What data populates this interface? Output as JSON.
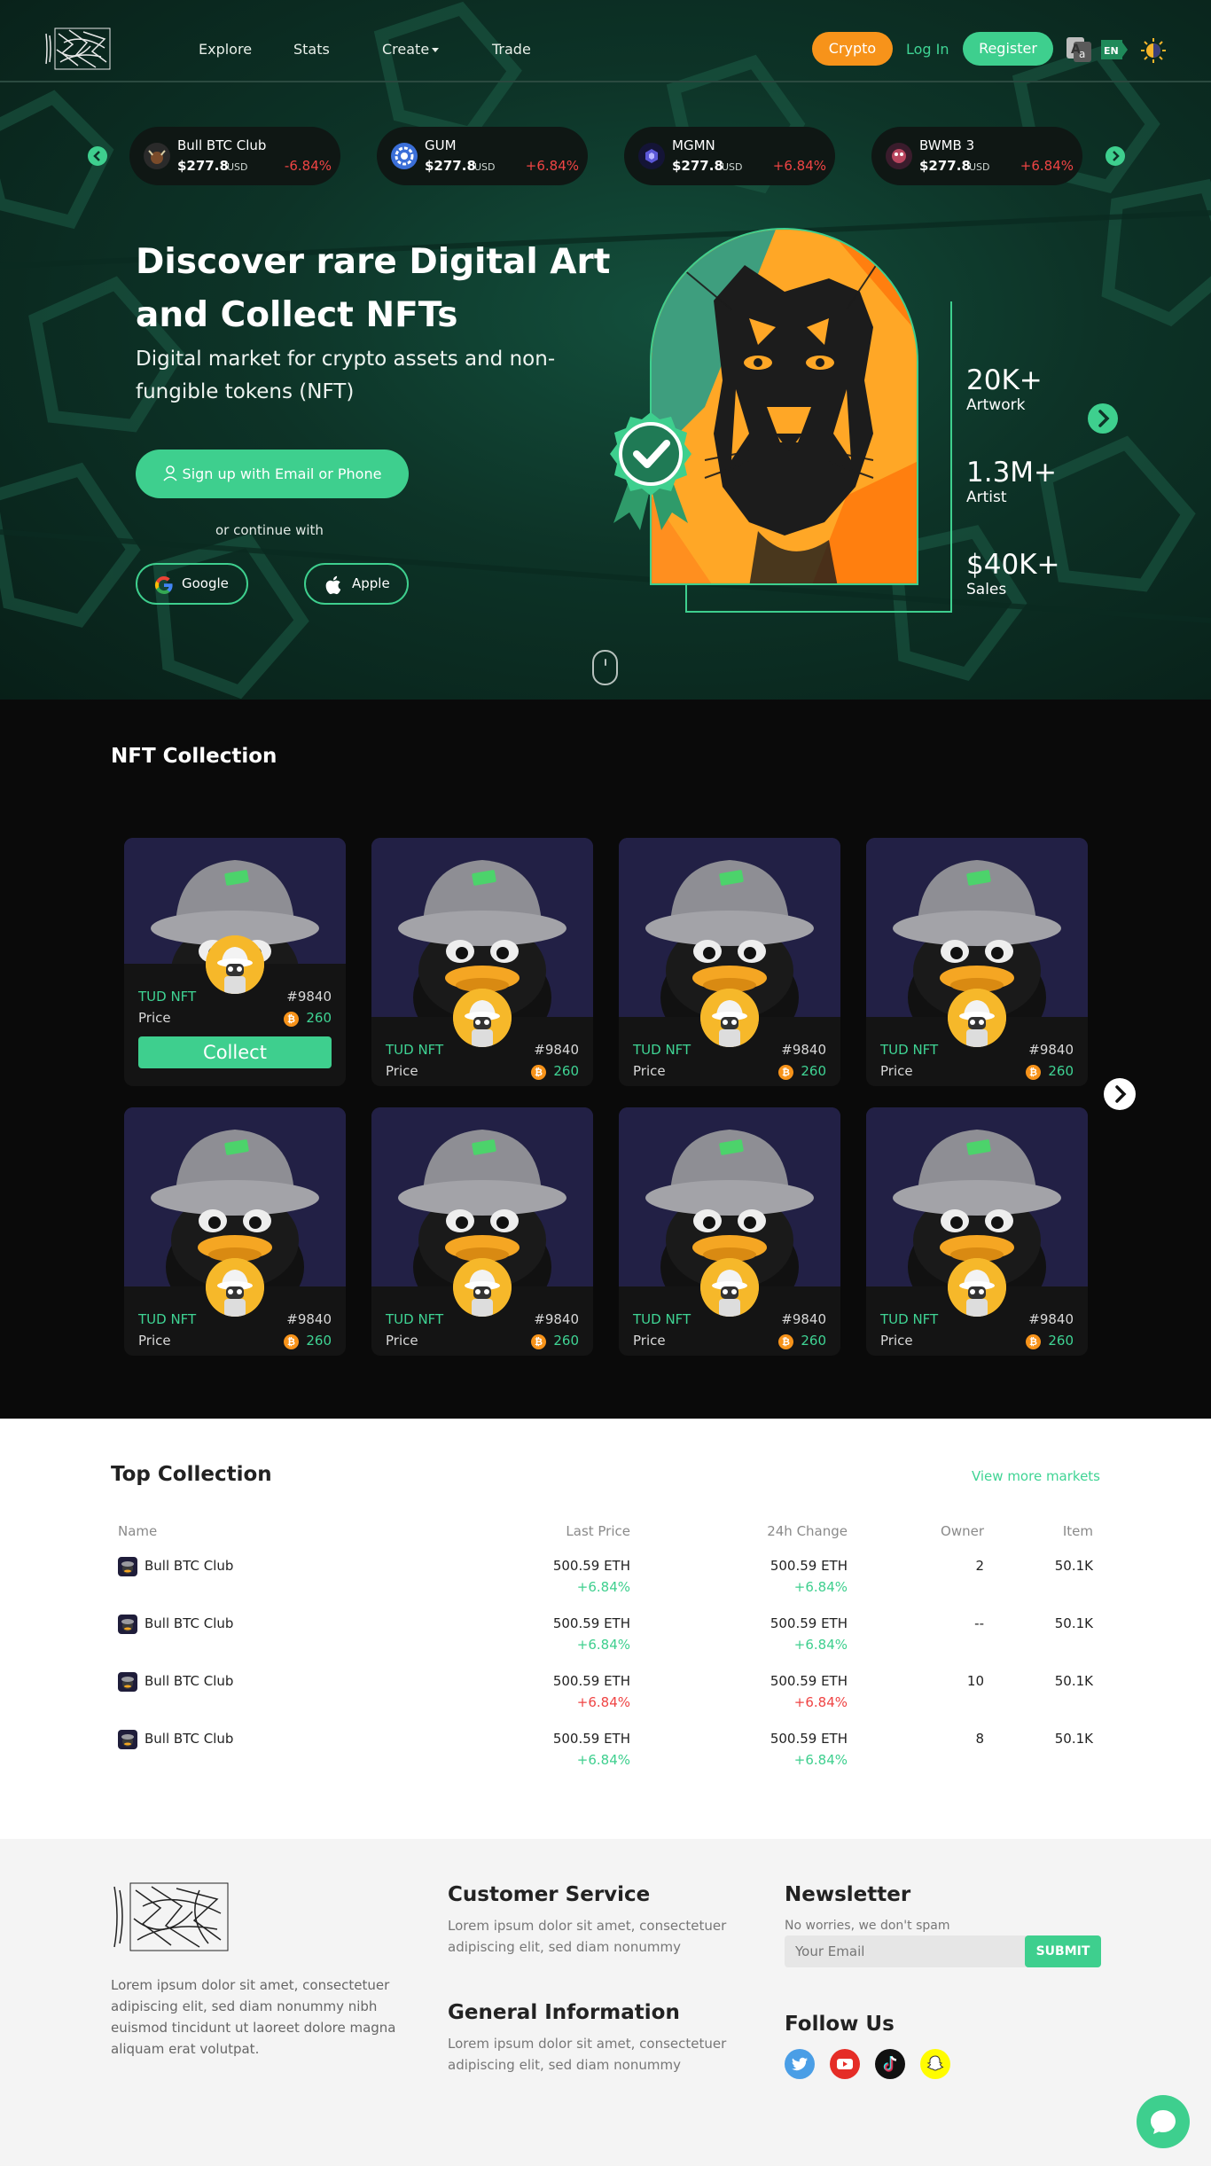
{
  "nav": {
    "links": [
      "Explore",
      "Stats",
      "Create",
      "Trade"
    ],
    "crypto_label": "Crypto",
    "login_label": "Log In",
    "register_label": "Register",
    "lang_label": "EN"
  },
  "ticker": [
    {
      "name": "Bull BTC Club",
      "price": "$277.8",
      "unit": "USD",
      "change": "-6.84%",
      "dir": "neg"
    },
    {
      "name": "GUM",
      "price": "$277.8",
      "unit": "USD",
      "change": "+6.84%",
      "dir": "neg"
    },
    {
      "name": "MGMN",
      "price": "$277.8",
      "unit": "USD",
      "change": "+6.84%",
      "dir": "neg"
    },
    {
      "name": "BWMB 3",
      "price": "$277.8",
      "unit": "USD",
      "change": "+6.84%",
      "dir": "neg"
    }
  ],
  "hero": {
    "title_1": "Discover",
    "title_2": " rare ",
    "title_3": "Digital Art",
    "title_4": "and ",
    "title_5": "Collect NFTs",
    "subtitle": "Digital market for crypto assets and non-fungible tokens (NFT)",
    "signup_label": "Sign up with Email or Phone",
    "or_continue": "or continue with",
    "google_label": "Google",
    "apple_label": "Apple",
    "stats": [
      {
        "value": "20K+",
        "label": "Artwork"
      },
      {
        "value": "1.3M+",
        "label": "Artist"
      },
      {
        "value": "$40K+",
        "label": "Sales"
      }
    ]
  },
  "nft": {
    "title": "NFT Collection",
    "collect_label": "Collect",
    "cards": [
      {
        "name": "TUD NFT",
        "id": "#9840",
        "price_label": "Price",
        "coin": "₿",
        "price": "260"
      },
      {
        "name": "TUD NFT",
        "id": "#9840",
        "price_label": "Price",
        "coin": "₿",
        "price": "260"
      },
      {
        "name": "TUD NFT",
        "id": "#9840",
        "price_label": "Price",
        "coin": "₿",
        "price": "260"
      },
      {
        "name": "TUD NFT",
        "id": "#9840",
        "price_label": "Price",
        "coin": "₿",
        "price": "260"
      },
      {
        "name": "TUD NFT",
        "id": "#9840",
        "price_label": "Price",
        "coin": "₿",
        "price": "260"
      },
      {
        "name": "TUD NFT",
        "id": "#9840",
        "price_label": "Price",
        "coin": "₿",
        "price": "260"
      },
      {
        "name": "TUD NFT",
        "id": "#9840",
        "price_label": "Price",
        "coin": "₿",
        "price": "260"
      },
      {
        "name": "TUD NFT",
        "id": "#9840",
        "price_label": "Price",
        "coin": "₿",
        "price": "260"
      }
    ]
  },
  "top": {
    "title": "Top Collection",
    "view_more": "View more markets",
    "headers": {
      "name": "Name",
      "last_price": "Last Price",
      "change": "24h Change",
      "owner": "Owner",
      "item": "Item"
    },
    "rows": [
      {
        "name": "Bull BTC Club",
        "last_price": "500.59 ETH",
        "last_change": "+6.84%",
        "last_dir": "pos",
        "change_price": "500.59 ETH",
        "change_pct": "+6.84%",
        "change_dir": "pos",
        "owner": "2",
        "item": "50.1K"
      },
      {
        "name": "Bull BTC Club",
        "last_price": "500.59 ETH",
        "last_change": "+6.84%",
        "last_dir": "pos",
        "change_price": "500.59 ETH",
        "change_pct": "+6.84%",
        "change_dir": "pos",
        "owner": "--",
        "item": "50.1K"
      },
      {
        "name": "Bull BTC Club",
        "last_price": "500.59 ETH",
        "last_change": "+6.84%",
        "last_dir": "neg",
        "change_price": "500.59 ETH",
        "change_pct": "+6.84%",
        "change_dir": "neg",
        "owner": "10",
        "item": "50.1K"
      },
      {
        "name": "Bull BTC Club",
        "last_price": "500.59 ETH",
        "last_change": "+6.84%",
        "last_dir": "pos",
        "change_price": "500.59 ETH",
        "change_pct": "+6.84%",
        "change_dir": "pos",
        "owner": "8",
        "item": "50.1K"
      }
    ]
  },
  "footer": {
    "about": "Lorem ipsum dolor sit amet, consectetuer adipiscing elit, sed diam nonummy nibh euismod tincidunt ut laoreet dolore magna aliquam erat volutpat.",
    "customer_title": "Customer Service",
    "customer_text": "Lorem ipsum dolor sit amet, consectetuer adipiscing elit, sed diam nonummy",
    "general_title": "General Information",
    "general_text": "Lorem ipsum dolor sit amet, consectetuer adipiscing elit, sed diam nonummy",
    "newsletter_title": "Newsletter",
    "newsletter_text": "No worries, we don't spam",
    "email_placeholder": "Your Email",
    "submit_label": "SUBMIT",
    "follow_title": "Follow Us",
    "socials": [
      "twitter-icon",
      "youtube-icon",
      "tiktok-icon",
      "snapchat-icon"
    ]
  },
  "colors": {
    "accent": "#3ecf8e",
    "crypto": "#f7931a",
    "negative": "#ef4444"
  }
}
